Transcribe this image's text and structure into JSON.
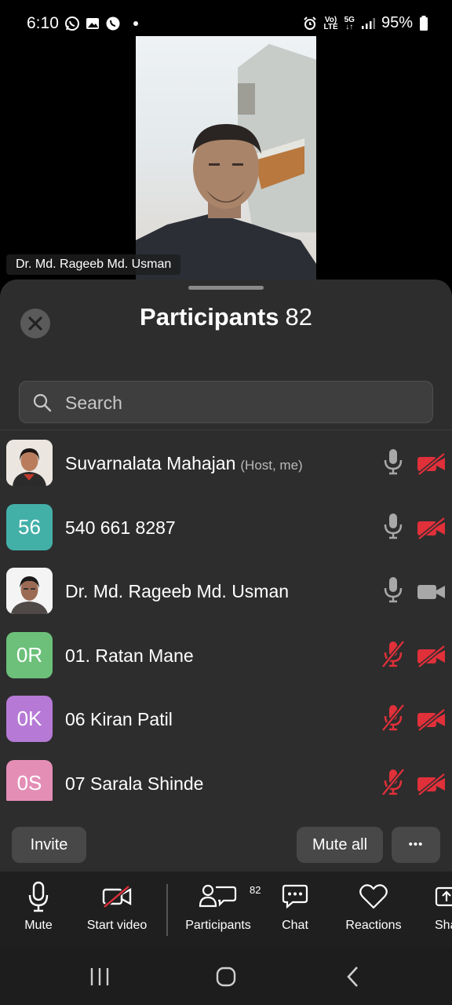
{
  "status": {
    "time": "6:10",
    "battery": "95%",
    "net_top": "Vo)",
    "net_bottom": "LTE",
    "net2_top": "5G",
    "net2_bottom": "↓↑"
  },
  "video": {
    "speaker_name": "Dr. Md. Rageeb Md. Usman"
  },
  "panel": {
    "title": "Participants",
    "count": "82",
    "search_placeholder": "Search",
    "participants": [
      {
        "name": "Suvarnalata Mahajan",
        "tag": "(Host, me)",
        "initials": "",
        "avatar_color": "#d9a87e",
        "mic": "on",
        "video": "off"
      },
      {
        "name": "540 661 8287",
        "tag": "",
        "initials": "56",
        "avatar_color": "#43b0a8",
        "mic": "on",
        "video": "off"
      },
      {
        "name": "Dr. Md. Rageeb Md. Usman",
        "tag": "",
        "initials": "",
        "avatar_color": "#e8e8e8",
        "mic": "on",
        "video": "on"
      },
      {
        "name": "01. Ratan Mane",
        "tag": "",
        "initials": "0R",
        "avatar_color": "#6cc07a",
        "mic": "off",
        "video": "off"
      },
      {
        "name": "06 Kiran Patil",
        "tag": "",
        "initials": "0K",
        "avatar_color": "#b67ad6",
        "mic": "off",
        "video": "off"
      },
      {
        "name": "07 Sarala Shinde",
        "tag": "",
        "initials": "0S",
        "avatar_color": "#e48eb6",
        "mic": "off",
        "video": "off"
      }
    ]
  },
  "actions": {
    "invite": "Invite",
    "mute_all": "Mute all",
    "more": "•••"
  },
  "toolbar": {
    "mute": "Mute",
    "start_video": "Start video",
    "participants": "Participants",
    "participants_badge": "82",
    "chat": "Chat",
    "reactions": "Reactions",
    "share": "Sha"
  },
  "colors": {
    "accent_red": "#e0303a",
    "icon_gray": "#a8a8a8",
    "sheet_bg": "#2d2d2d"
  }
}
